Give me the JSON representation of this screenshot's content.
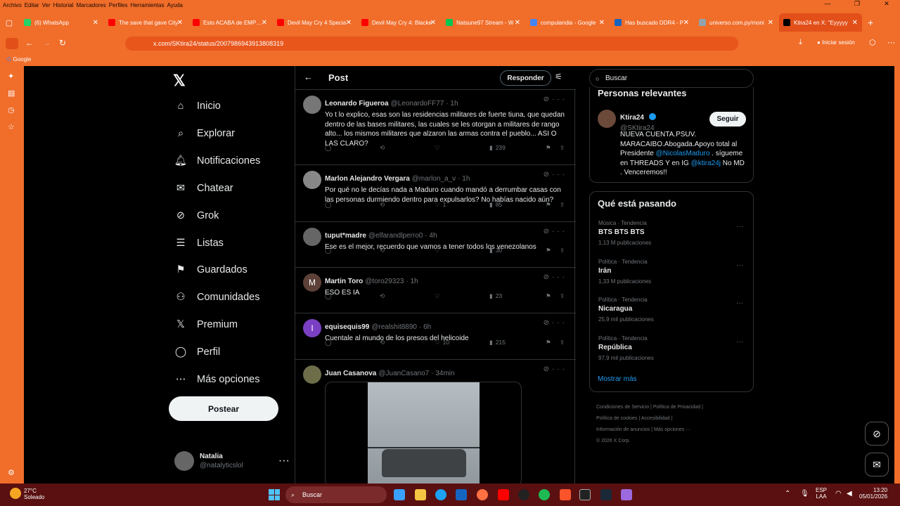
{
  "menu": [
    "Archivo",
    "Editar",
    "Ver",
    "Historial",
    "Marcadores",
    "Perfiles",
    "Herramientas",
    "Ayuda"
  ],
  "tabs": [
    {
      "title": "(6) WhatsApp",
      "color": "#25d366"
    },
    {
      "title": "The save that gave City",
      "color": "#ff0000"
    },
    {
      "title": "Esto ACABA de EMPEZA",
      "color": "#ff0000"
    },
    {
      "title": "Devil May Cry 4 Specia",
      "color": "#ff0000"
    },
    {
      "title": "Devil May Cry 4: Blacke",
      "color": "#ff0000"
    },
    {
      "title": "Natsune97 Stream - W",
      "color": "#00c853"
    },
    {
      "title": "compulandia - Google",
      "color": "#4285f4"
    },
    {
      "title": "Has buscado DDR4 - P",
      "color": "#1565c0"
    },
    {
      "title": "universo.com.py/moni",
      "color": "#90a4ae"
    },
    {
      "title": "Ktira24 en X: \"Eyyyyy",
      "color": "#000000"
    }
  ],
  "address": {
    "url": "x.com/SKtira24/status/2007986943913808319",
    "signin": "Iniciar sesión"
  },
  "bookmarks": {
    "google": "Google"
  },
  "nav": {
    "items": [
      "Inicio",
      "Explorar",
      "Notificaciones",
      "Chatear",
      "Grok",
      "Listas",
      "Guardados",
      "Comunidades",
      "Premium",
      "Perfil",
      "Más opciones"
    ],
    "post_button": "Postear",
    "user_name": "Natalia",
    "user_handle": "@natalyticslol"
  },
  "feed": {
    "title": "Post",
    "reply_button": "Responder",
    "tweets": [
      {
        "name": "Leonardo Figueroa",
        "handle": "@LeonardoFF77",
        "time": "· 1h",
        "text": "Yo t lo explico, esas son las residencias militares de fuerte tiuna, que quedan dentro de las bases militares, las cuales se les otorgan a militares de rango alto... los mismos militares que alzaron las armas contra el pueblo... ASI O LAS CLARO?",
        "likes": "",
        "views": "239",
        "avatar_color": "#777"
      },
      {
        "name": "Marlon Alejandro Vergara",
        "handle": "@marlon_a_v",
        "time": "· 1h",
        "text": "Por qué no le decías nada a Maduro cuando mandó a derrumbar casas con las personas durmiendo dentro para expulsarlos? No habías nacido aún?",
        "likes": "1",
        "views": "85",
        "avatar_color": "#888"
      },
      {
        "name": "tuput*madre",
        "handle": "@elfarandlperro0",
        "time": "· 4h",
        "text": "Ese es el mejor, recuerdo que vamos a tener todos los venezolanos",
        "likes": "",
        "views": "30",
        "avatar_color": "#666"
      },
      {
        "name": "Martin Toro",
        "handle": "@toro29323",
        "time": "· 1h",
        "text": "ESO ES IA",
        "likes": "",
        "views": "23",
        "avatar_color": "#5d4037",
        "initial": "M"
      },
      {
        "name": "equisequis99",
        "handle": "@realshit8890",
        "time": "· 6h",
        "text": "Cuentale al mundo de los presos del helicoide",
        "likes": "10",
        "views": "215",
        "avatar_color": "#7b3fc4",
        "initial": "I"
      },
      {
        "name": "Juan Casanova",
        "handle": "@JuanCasano7",
        "time": "· 34min",
        "text": "",
        "likes": "",
        "views": "",
        "avatar_color": "#6d6d4a"
      }
    ]
  },
  "right": {
    "search_placeholder": "Buscar",
    "relevant_title": "Personas relevantes",
    "profile": {
      "name": "Ktira24",
      "handle": "@SKtira24",
      "follow": "Seguir",
      "bio_1": "NUEVA CUENTA.PSUV. MARACAIBO.Abogada.Apoyo total al Presidente ",
      "mention_1": "@NicolasMaduro",
      "bio_2": " . sígueme en THREADS Y en IG ",
      "mention_2": "@ktira24j",
      "bio_3": " No MD . Venceremos!!"
    },
    "trends_title": "Qué está pasando",
    "trends": [
      {
        "cat": "Música · Tendencia",
        "title": "BTS BTS BTS",
        "count": "1,13 M publicaciones"
      },
      {
        "cat": "Política · Tendencia",
        "title": "Irán",
        "count": "1,33 M publicaciones"
      },
      {
        "cat": "Política · Tendencia",
        "title": "Nicaragua",
        "count": "25,9 mil publicaciones"
      },
      {
        "cat": "Política · Tendencia",
        "title": "República",
        "count": "97,9 mil publicaciones"
      }
    ],
    "show_more": "Mostrar más",
    "footer": {
      "l1a": "Condiciones de Servicio",
      "l1b": "Política de Privacidad",
      "l2a": "Política de cookies",
      "l2b": "Accesibilidad",
      "l3a": "Información de anuncios",
      "l3b": "Más opciones ···",
      "l4": "© 2026 X Corp."
    }
  },
  "taskbar": {
    "temp": "27°C",
    "weather": "Soleado",
    "search": "Buscar",
    "lang": "ESP",
    "lang2": "LAA",
    "time": "13:20",
    "date": "05/01/2026"
  }
}
